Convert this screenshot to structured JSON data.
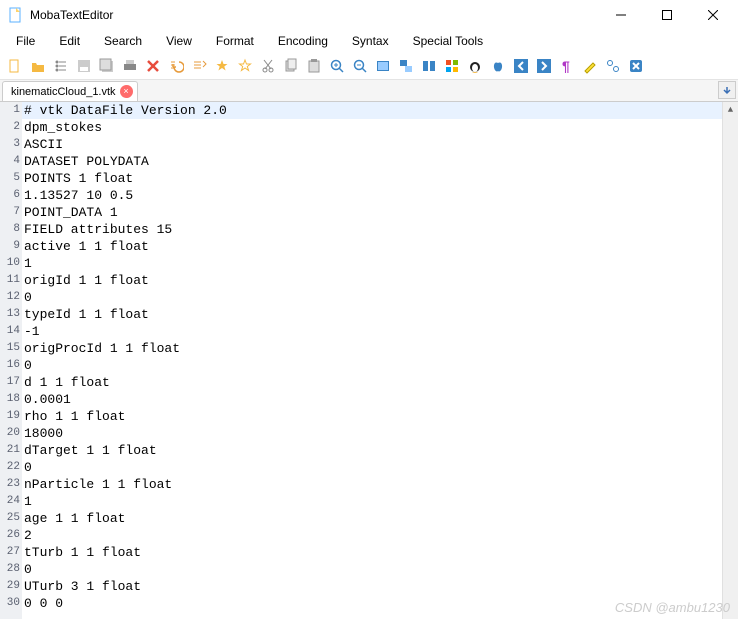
{
  "app": {
    "title": "MobaTextEditor"
  },
  "menu": [
    "File",
    "Edit",
    "Search",
    "View",
    "Format",
    "Encoding",
    "Syntax",
    "Special Tools"
  ],
  "toolbar_icons": [
    "new-file-icon",
    "open-folder-icon",
    "tree-icon",
    "save-icon",
    "save-all-icon",
    "print-icon",
    "close-icon",
    "undo-icon",
    "redo-icon",
    "star-icon",
    "star-outline-icon",
    "cut-icon",
    "copy-icon",
    "paste-icon",
    "zoom-in-icon",
    "zoom-out-icon",
    "find-icon",
    "replace-icon",
    "compare-icon",
    "windows-icon",
    "linux-icon",
    "apple-icon",
    "back-icon",
    "forward-icon",
    "pilcrow-icon",
    "highlight-icon",
    "settings-icon",
    "close-x-icon"
  ],
  "tab": {
    "name": "kinematicCloud_1.vtk"
  },
  "lines": [
    "# vtk DataFile Version 2.0",
    "dpm_stokes",
    "ASCII",
    "DATASET POLYDATA",
    "POINTS 1 float",
    "1.13527 10 0.5",
    "POINT_DATA 1",
    "FIELD attributes 15",
    "active 1 1 float",
    "1",
    "origId 1 1 float",
    "0",
    "typeId 1 1 float",
    "-1",
    "origProcId 1 1 float",
    "0",
    "d 1 1 float",
    "0.0001",
    "rho 1 1 float",
    "18000",
    "dTarget 1 1 float",
    "0",
    "nParticle 1 1 float",
    "1",
    "age 1 1 float",
    "2",
    "tTurb 1 1 float",
    "0",
    "UTurb 3 1 float",
    "0 0 0"
  ],
  "watermark": "CSDN @ambu1230"
}
